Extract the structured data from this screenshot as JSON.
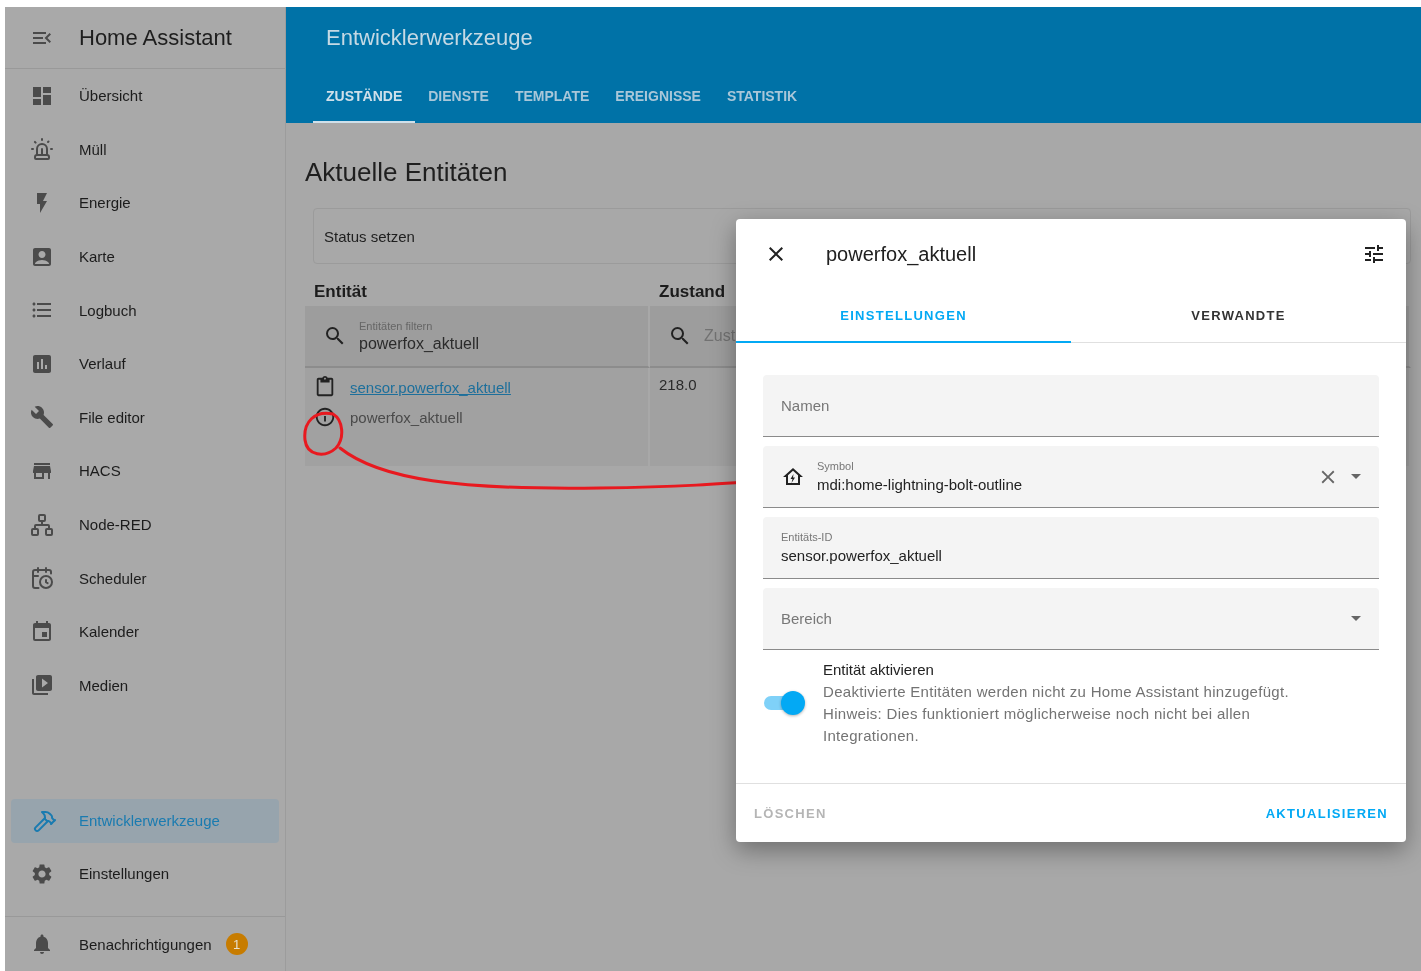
{
  "sidebar": {
    "title": "Home Assistant",
    "items": [
      {
        "label": "Übersicht",
        "selected": false
      },
      {
        "label": "Müll",
        "selected": false
      },
      {
        "label": "Energie",
        "selected": false
      },
      {
        "label": "Karte",
        "selected": false
      },
      {
        "label": "Logbuch",
        "selected": false
      },
      {
        "label": "Verlauf",
        "selected": false
      },
      {
        "label": "File editor",
        "selected": false
      },
      {
        "label": "HACS",
        "selected": false
      },
      {
        "label": "Node-RED",
        "selected": false
      },
      {
        "label": "Scheduler",
        "selected": false
      },
      {
        "label": "Kalender",
        "selected": false
      },
      {
        "label": "Medien",
        "selected": false
      }
    ],
    "bottom_items": [
      {
        "label": "Entwicklerwerkzeuge",
        "selected": true
      },
      {
        "label": "Einstellungen",
        "selected": false
      }
    ],
    "notifications": {
      "label": "Benachrichtigungen",
      "badge": "1"
    }
  },
  "header": {
    "title": "Entwicklerwerkzeuge",
    "tabs": [
      {
        "label": "ZUSTÄNDE",
        "selected": true
      },
      {
        "label": "DIENSTE",
        "selected": false
      },
      {
        "label": "TEMPLATE",
        "selected": false
      },
      {
        "label": "EREIGNISSE",
        "selected": false
      },
      {
        "label": "STATISTIK",
        "selected": false
      }
    ]
  },
  "content": {
    "title": "Aktuelle Entitäten",
    "status_card": "Status setzen",
    "table": {
      "columns": [
        "Entität",
        "Zustand"
      ],
      "filters": [
        {
          "label": "Entitäten filtern",
          "value": "powerfox_aktuell"
        },
        {
          "placeholder": "Zust"
        }
      ],
      "rows": [
        {
          "entity_id": "sensor.powerfox_aktuell",
          "name": "powerfox_aktuell",
          "state": "218.0"
        }
      ]
    }
  },
  "dialog": {
    "title": "powerfox_aktuell",
    "tabs": [
      {
        "label": "EINSTELLUNGEN",
        "selected": true
      },
      {
        "label": "VERWANDTE",
        "selected": false
      }
    ],
    "fields": [
      {
        "kind": "text",
        "placeholder": "Namen"
      },
      {
        "kind": "icon",
        "label": "Symbol",
        "value": "mdi:home-lightning-bolt-outline"
      },
      {
        "kind": "text",
        "label": "Entitäts-ID",
        "value": "sensor.powerfox_aktuell"
      },
      {
        "kind": "select",
        "placeholder": "Bereich"
      }
    ],
    "enable": {
      "title": "Entität aktivieren",
      "description": "Deaktivierte Entitäten werden nicht zu Home Assistant hinzugefügt. Hinweis: Dies funktioniert möglicherweise noch nicht bei allen Integrationen.",
      "on": true
    },
    "actions": [
      {
        "kind": "delete",
        "label": "LÖSCHEN"
      },
      {
        "kind": "update",
        "label": "AKTUALISIEREN"
      }
    ]
  }
}
